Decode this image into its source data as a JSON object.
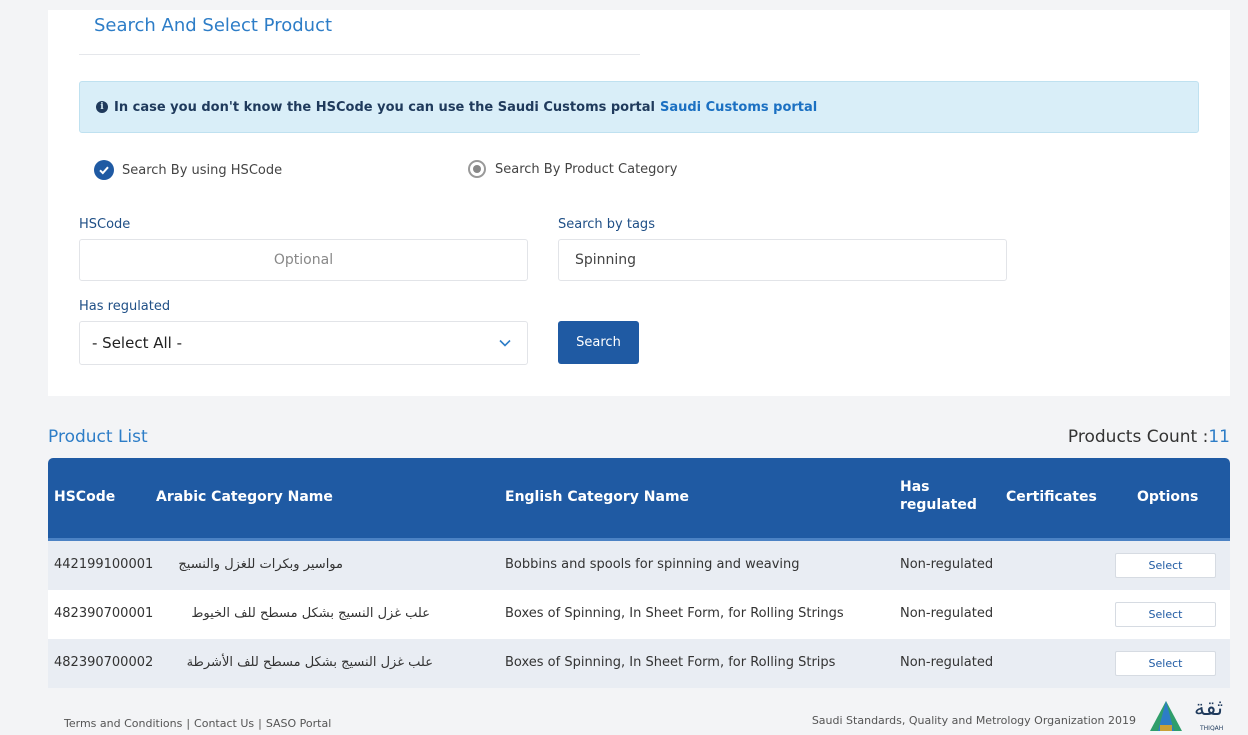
{
  "search_section": {
    "title": "Search And Select Product",
    "alert_text": "In case you don't know the HSCode you can use the Saudi Customs portal",
    "alert_link": "Saudi Customs portal",
    "radio_hscode": "Search By using HSCode",
    "radio_category": "Search By Product Category",
    "hscode_label": "HSCode",
    "hscode_placeholder": "Optional",
    "tags_label": "Search by tags",
    "tags_value": "Spinning",
    "regulated_label": "Has regulated",
    "regulated_selected": "- Select All -",
    "search_button": "Search"
  },
  "product_list": {
    "title": "Product List",
    "count_label": "Products Count :",
    "count_value": "11",
    "columns": {
      "hscode": "HSCode",
      "arabic": "Arabic Category Name",
      "english": "English Category Name",
      "regulated_line1": "Has",
      "regulated_line2": "regulated",
      "certificates": "Certificates",
      "options": "Options"
    },
    "rows": [
      {
        "hscode": "442199100001",
        "arabic": "مواسير وبكرات للغزل والنسيج",
        "english": "Bobbins and spools for spinning and weaving",
        "regulated": "Non-regulated",
        "action": "Select"
      },
      {
        "hscode": "482390700001",
        "arabic": "علب غزل النسيج بشكل مسطح للف الخيوط",
        "english": "Boxes of Spinning, In Sheet Form, for Rolling Strings",
        "regulated": "Non-regulated",
        "action": "Select"
      },
      {
        "hscode": "482390700002",
        "arabic": "علب غزل النسيج بشكل مسطح للف الأشرطة",
        "english": "Boxes of Spinning, In Sheet Form, for Rolling Strips",
        "regulated": "Non-regulated",
        "action": "Select"
      }
    ]
  },
  "footer": {
    "terms": "Terms and Conditions",
    "contact": "Contact Us",
    "portal": "SASO Portal",
    "separator": "|",
    "org": "Saudi Standards, Quality and Metrology Organization 2019",
    "logo_text": "ثقة",
    "logo_sub": "THIQAH"
  },
  "colors": {
    "primary": "#1f5aa3",
    "link": "#2d7dc7",
    "alert_bg": "#d9eef8"
  }
}
